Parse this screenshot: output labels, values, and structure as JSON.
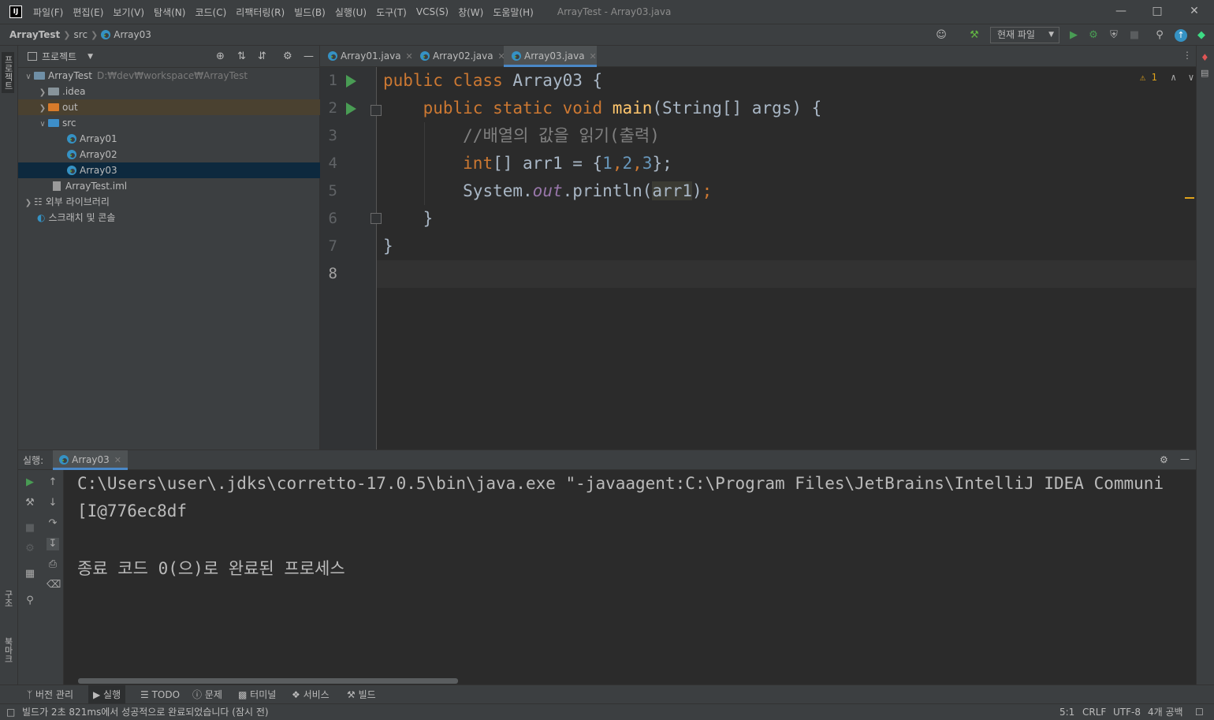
{
  "menu": {
    "items": [
      "파일(F)",
      "편집(E)",
      "보기(V)",
      "탐색(N)",
      "코드(C)",
      "리팩터링(R)",
      "빌드(B)",
      "실행(U)",
      "도구(T)",
      "VCS(S)",
      "창(W)",
      "도움말(H)"
    ],
    "window_title": "ArrayTest - Array03.java"
  },
  "breadcrumb": {
    "project": "ArrayTest",
    "folder": "src",
    "file": "Array03"
  },
  "toolbar": {
    "run_config": "현재 파일"
  },
  "left_strip": {
    "project_tab": "프로젝트",
    "structure_tab": "구조",
    "bookmarks_tab": "북마크"
  },
  "project_panel": {
    "title": "프로젝트",
    "tree": {
      "root": "ArrayTest",
      "root_path": "D:₩dev₩workspace₩ArrayTest",
      "idea": ".idea",
      "out": "out",
      "src": "src",
      "file1": "Array01",
      "file2": "Array02",
      "file3": "Array03",
      "iml": "ArrayTest.iml",
      "libs": "외부 라이브러리",
      "scratch": "스크래치 및 콘솔"
    }
  },
  "editor": {
    "tabs": [
      "Array01.java",
      "Array02.java",
      "Array03.java"
    ],
    "active_tab": "Array03.java",
    "warnings": "1",
    "line_numbers": [
      "1",
      "2",
      "3",
      "4",
      "5",
      "6",
      "7",
      "8"
    ],
    "code": {
      "l1_kw": "public class ",
      "l1_name": "Array03 {",
      "l2_kw": "public static void ",
      "l2_fn": "main",
      "l2_rest": "(String[] args) {",
      "l3_comment": "//배열의 값을 읽기(출력)",
      "l4_kw": "int",
      "l4_rest1": "[] arr1 = {",
      "l4_n1": "1",
      "l4_n2": "2",
      "l4_n3": "3",
      "l4_end": "};",
      "l5_a": "System.",
      "l5_out": "out",
      "l5_b": ".println(",
      "l5_arg": "arr1",
      "l5_c": ")",
      "l5_semi": ";",
      "l6": "}",
      "l7": "}"
    }
  },
  "run_panel": {
    "label": "실행:",
    "tab": "Array03",
    "console": [
      "C:\\Users\\user\\.jdks\\corretto-17.0.5\\bin\\java.exe \"-javaagent:C:\\Program Files\\JetBrains\\IntelliJ IDEA Communi",
      "[I@776ec8df",
      "종료 코드 0(으)로 완료된 프로세스"
    ]
  },
  "bottom_tools": [
    "버전 관리",
    "실행",
    "TODO",
    "문제",
    "터미널",
    "서비스",
    "빌드"
  ],
  "status": {
    "message": "빌드가 2초 821ms에서 성공적으로 완료되었습니다 (잠시 전)",
    "position": "5:1",
    "line_sep": "CRLF",
    "encoding": "UTF-8",
    "indent": "4개 공백"
  },
  "colors": {
    "keyword": "#cc7832",
    "function": "#ffc66d",
    "number": "#6897bb",
    "comment": "#808080",
    "field": "#9876aa",
    "run": "#499c54",
    "accent": "#4a88c7"
  }
}
